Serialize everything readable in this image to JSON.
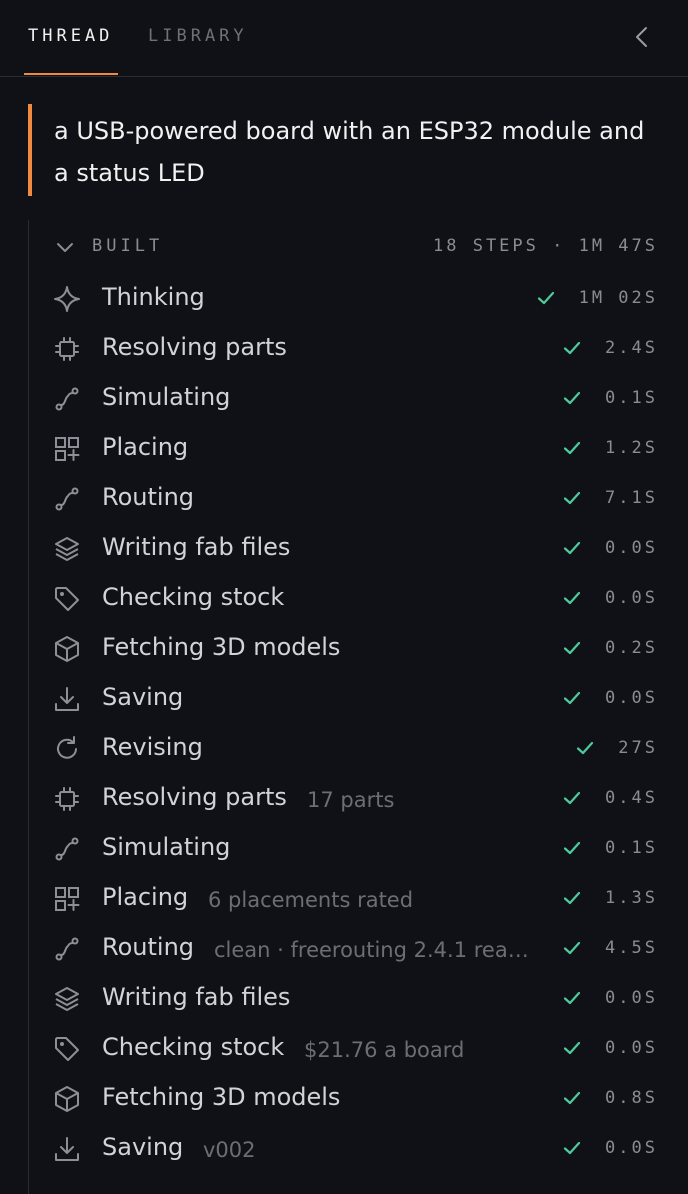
{
  "tabs": [
    {
      "label": "THREAD",
      "active": true
    },
    {
      "label": "LIBRARY",
      "active": false
    }
  ],
  "collapse_icon": "chevron-left-icon",
  "prompt": "a USB-powered board with an ESP32 module and a status LED",
  "built": {
    "label": "BUILT",
    "meta": "18 STEPS · 1M 47S"
  },
  "colors": {
    "accent": "#f08a3e",
    "success": "#4ecb9a",
    "background": "#101116"
  },
  "steps": [
    {
      "icon": "sparkle-icon",
      "label": "Thinking",
      "detail": "",
      "time": "1M 02S"
    },
    {
      "icon": "chip-icon",
      "label": "Resolving parts",
      "detail": "",
      "time": "2.4S"
    },
    {
      "icon": "route-icon",
      "label": "Simulating",
      "detail": "",
      "time": "0.1S"
    },
    {
      "icon": "grid-plus-icon",
      "label": "Placing",
      "detail": "",
      "time": "1.2S"
    },
    {
      "icon": "route-icon",
      "label": "Routing",
      "detail": "",
      "time": "7.1S"
    },
    {
      "icon": "layers-icon",
      "label": "Writing fab files",
      "detail": "",
      "time": "0.0S"
    },
    {
      "icon": "tag-icon",
      "label": "Checking stock",
      "detail": "",
      "time": "0.0S"
    },
    {
      "icon": "cube-icon",
      "label": "Fetching 3D models",
      "detail": "",
      "time": "0.2S"
    },
    {
      "icon": "download-icon",
      "label": "Saving",
      "detail": "",
      "time": "0.0S"
    },
    {
      "icon": "refresh-icon",
      "label": "Revising",
      "detail": "",
      "time": "27S"
    },
    {
      "icon": "chip-icon",
      "label": "Resolving parts",
      "detail": "17 parts",
      "time": "0.4S"
    },
    {
      "icon": "route-icon",
      "label": "Simulating",
      "detail": "",
      "time": "0.1S"
    },
    {
      "icon": "grid-plus-icon",
      "label": "Placing",
      "detail": "6 placements rated",
      "time": "1.3S"
    },
    {
      "icon": "route-icon",
      "label": "Routing",
      "detail": "clean · freerouting 2.4.1 rea…",
      "time": "4.5S"
    },
    {
      "icon": "layers-icon",
      "label": "Writing fab files",
      "detail": "",
      "time": "0.0S"
    },
    {
      "icon": "tag-icon",
      "label": "Checking stock",
      "detail": "$21.76 a board",
      "time": "0.0S"
    },
    {
      "icon": "cube-icon",
      "label": "Fetching 3D models",
      "detail": "",
      "time": "0.8S"
    },
    {
      "icon": "download-icon",
      "label": "Saving",
      "detail": "v002",
      "time": "0.0S"
    }
  ]
}
